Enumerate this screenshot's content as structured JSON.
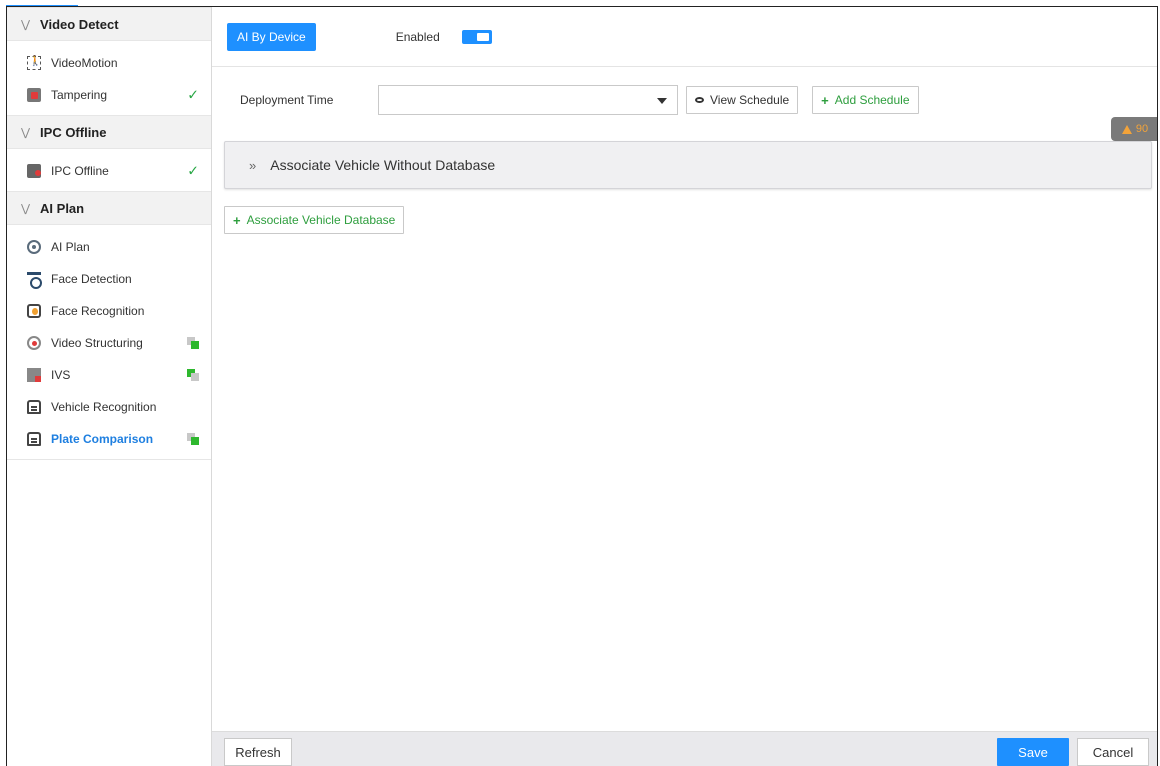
{
  "sidebar": {
    "sections": [
      {
        "title": "Video Detect",
        "items": [
          {
            "label": "VideoMotion",
            "icon": "motion-icon",
            "status": ""
          },
          {
            "label": "Tampering",
            "icon": "tampering-icon",
            "status": "check"
          }
        ]
      },
      {
        "title": "IPC Offline",
        "items": [
          {
            "label": "IPC Offline",
            "icon": "ipc-offline-icon",
            "status": "check"
          }
        ]
      },
      {
        "title": "AI Plan",
        "items": [
          {
            "label": "AI Plan",
            "icon": "ai-plan-icon",
            "status": ""
          },
          {
            "label": "Face Detection",
            "icon": "face-detection-icon",
            "status": ""
          },
          {
            "label": "Face Recognition",
            "icon": "face-recognition-icon",
            "status": ""
          },
          {
            "label": "Video Structuring",
            "icon": "video-structuring-icon",
            "status": "device"
          },
          {
            "label": "IVS",
            "icon": "ivs-icon",
            "status": "device-alt"
          },
          {
            "label": "Vehicle Recognition",
            "icon": "vehicle-icon",
            "status": ""
          },
          {
            "label": "Plate Comparison",
            "icon": "vehicle-icon",
            "status": "device",
            "active": true
          }
        ]
      }
    ]
  },
  "main": {
    "tab_label": "AI By Device",
    "enabled_label": "Enabled",
    "enabled": true,
    "deployment_label": "Deployment Time",
    "deployment_value": "",
    "view_schedule_label": "View Schedule",
    "add_schedule_label": "Add Schedule",
    "warning_count": "90",
    "associate_panel_label": "Associate Vehicle Without Database",
    "add_database_label": "Associate Vehicle Database"
  },
  "footer": {
    "refresh_label": "Refresh",
    "save_label": "Save",
    "cancel_label": "Cancel"
  },
  "colors": {
    "accent": "#1e90ff",
    "success": "#2e9e3e",
    "active_text": "#1e7fe0",
    "warning": "#f2a33a"
  }
}
